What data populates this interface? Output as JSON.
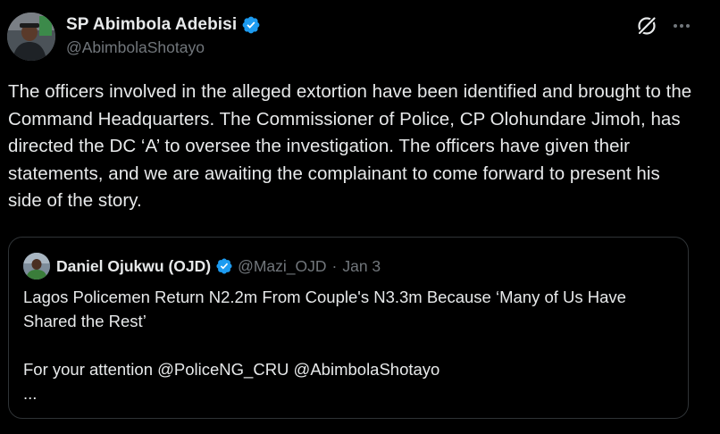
{
  "author": {
    "display_name": "SP Abimbola Adebisi",
    "handle": "@AbimbolaShotayo",
    "verified": true,
    "avatar_icon": "profile-photo"
  },
  "actions": {
    "grok_icon": "grok-icon",
    "more_icon": "more-icon"
  },
  "tweet": {
    "text": "The officers involved in the alleged extortion have been identified and brought to the Command Headquarters. The Commissioner of Police, CP Olohundare Jimoh, has directed the DC ‘A’ to oversee the investigation. The officers have given their statements, and we are awaiting the complainant to come forward to present his side of the story."
  },
  "quote": {
    "display_name": "Daniel Ojukwu (OJD)",
    "handle": "@Mazi_OJD",
    "separator": "·",
    "date": "Jan 3",
    "verified": true,
    "text": "Lagos Policemen Return N2.2m From Couple's N3.3m Because ‘Many of Us Have Shared the Rest’\n\nFor your attention @PoliceNG_CRU @AbimbolaShotayo\n..."
  },
  "colors": {
    "background": "#000000",
    "text_primary": "#e7e9ea",
    "text_secondary": "#71767b",
    "verified_blue": "#1d9bf0",
    "border": "#2f3336"
  }
}
